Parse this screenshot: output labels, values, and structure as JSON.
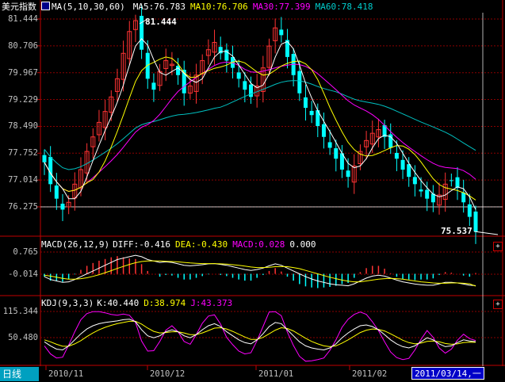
{
  "window": {
    "tab_label": "日线",
    "cursor_date": "2011/03/14,一"
  },
  "main_panel": {
    "title": "美元指数",
    "indicator": "MA(5,10,30,60)",
    "ma5": "MA5:76.783",
    "ma10": "MA10:76.706",
    "ma30": "MA30:77.399",
    "ma60": "MA60:78.418",
    "y_ticks": [
      "81.444",
      "80.706",
      "79.967",
      "79.229",
      "78.490",
      "77.752",
      "77.014",
      "76.275"
    ],
    "high_label": "81.444",
    "low_label": "75.537"
  },
  "macd_panel": {
    "title": "MACD(26,12,9)",
    "diff": "DIFF:-0.416",
    "dea": "DEA:-0.430",
    "macd": "MACD:0.028",
    "extra": "0.000",
    "y_ticks": [
      "0.765",
      "-0.014"
    ]
  },
  "kdj_panel": {
    "title": "KDJ(9,3,3)",
    "k": "K:40.440",
    "d": "D:38.974",
    "j": "J:43.373",
    "y_ticks": [
      "115.344",
      "50.480"
    ]
  },
  "x_axis": {
    "ticks": [
      "2010/11",
      "2010/12",
      "2011/01",
      "2011/02"
    ]
  },
  "colors": {
    "up": "#ff3333",
    "down": "#00ffff",
    "ma5": "#ffffff",
    "ma10": "#ffff00",
    "ma30": "#ff00ff",
    "ma60": "#00c0c0",
    "grid": "#8b0000",
    "axis": "#c00000",
    "text_gray": "#c0c0c0"
  },
  "icons": {
    "expand": "plus-icon"
  },
  "chart_data": {
    "type": "candlestick",
    "title": "美元指数",
    "price_range": [
      75.537,
      81.444
    ],
    "close": [
      77.5,
      76.9,
      76.5,
      76.2,
      76.4,
      76.9,
      77.3,
      77.8,
      78.2,
      78.6,
      78.9,
      79.3,
      79.8,
      80.5,
      81.1,
      81.4,
      80.6,
      79.8,
      79.5,
      80.0,
      80.3,
      80.2,
      79.9,
      79.4,
      79.6,
      79.9,
      80.3,
      80.6,
      80.8,
      80.5,
      80.3,
      80.1,
      79.8,
      79.5,
      79.3,
      79.6,
      80.1,
      80.7,
      81.2,
      81.0,
      80.4,
      79.9,
      79.4,
      79.0,
      78.8,
      78.5,
      78.2,
      77.9,
      77.6,
      77.3,
      77.1,
      77.4,
      77.8,
      78.1,
      78.3,
      78.4,
      78.2,
      77.9,
      77.6,
      77.3,
      77.1,
      76.9,
      76.7,
      76.5,
      76.4,
      76.6,
      76.9,
      77.0,
      76.8,
      76.4,
      76.0,
      75.6
    ],
    "macd_dif": [
      -0.1,
      -0.2,
      -0.25,
      -0.3,
      -0.28,
      -0.2,
      -0.1,
      0.0,
      0.1,
      0.2,
      0.3,
      0.4,
      0.5,
      0.55,
      0.6,
      0.65,
      0.6,
      0.5,
      0.45,
      0.4,
      0.42,
      0.4,
      0.35,
      0.3,
      0.28,
      0.3,
      0.32,
      0.35,
      0.36,
      0.33,
      0.3,
      0.25,
      0.2,
      0.15,
      0.12,
      0.15,
      0.2,
      0.28,
      0.35,
      0.3,
      0.2,
      0.1,
      0.0,
      -0.1,
      -0.18,
      -0.25,
      -0.3,
      -0.35,
      -0.38,
      -0.4,
      -0.42,
      -0.35,
      -0.25,
      -0.15,
      -0.08,
      -0.05,
      -0.08,
      -0.15,
      -0.22,
      -0.28,
      -0.32,
      -0.36,
      -0.38,
      -0.4,
      -0.4,
      -0.35,
      -0.3,
      -0.3,
      -0.32,
      -0.36,
      -0.4,
      -0.416
    ],
    "macd_dea": [
      -0.05,
      -0.08,
      -0.12,
      -0.16,
      -0.19,
      -0.19,
      -0.17,
      -0.14,
      -0.09,
      -0.03,
      0.04,
      0.11,
      0.19,
      0.26,
      0.33,
      0.39,
      0.43,
      0.45,
      0.45,
      0.45,
      0.44,
      0.43,
      0.42,
      0.4,
      0.38,
      0.37,
      0.36,
      0.36,
      0.36,
      0.35,
      0.34,
      0.32,
      0.3,
      0.27,
      0.24,
      0.22,
      0.22,
      0.23,
      0.25,
      0.26,
      0.25,
      0.22,
      0.18,
      0.12,
      0.06,
      0.0,
      -0.06,
      -0.12,
      -0.17,
      -0.22,
      -0.26,
      -0.28,
      -0.28,
      -0.25,
      -0.22,
      -0.19,
      -0.17,
      -0.16,
      -0.17,
      -0.19,
      -0.22,
      -0.25,
      -0.28,
      -0.3,
      -0.32,
      -0.33,
      -0.33,
      -0.32,
      -0.32,
      -0.33,
      -0.35,
      -0.43
    ],
    "kdj_k": [
      40,
      30,
      22,
      20,
      30,
      45,
      60,
      72,
      80,
      85,
      88,
      90,
      92,
      95,
      96,
      90,
      70,
      55,
      50,
      55,
      65,
      70,
      65,
      55,
      50,
      58,
      70,
      80,
      85,
      78,
      65,
      55,
      45,
      38,
      35,
      45,
      60,
      78,
      88,
      85,
      70,
      55,
      40,
      30,
      25,
      22,
      20,
      25,
      35,
      50,
      62,
      72,
      80,
      82,
      78,
      70,
      58,
      45,
      35,
      28,
      25,
      30,
      40,
      50,
      45,
      35,
      28,
      30,
      38,
      45,
      42,
      40.44
    ],
    "kdj_d": [
      45,
      40,
      34,
      29,
      29,
      35,
      43,
      53,
      62,
      70,
      76,
      81,
      85,
      88,
      91,
      91,
      84,
      74,
      66,
      62,
      63,
      65,
      65,
      62,
      58,
      58,
      62,
      68,
      74,
      75,
      72,
      66,
      59,
      52,
      46,
      46,
      51,
      60,
      69,
      75,
      73,
      67,
      58,
      49,
      41,
      35,
      30,
      28,
      30,
      37,
      45,
      54,
      63,
      69,
      72,
      71,
      67,
      60,
      52,
      44,
      38,
      35,
      37,
      41,
      42,
      40,
      36,
      34,
      35,
      38,
      39,
      38.974
    ],
    "kdj_j": [
      30,
      10,
      0,
      2,
      32,
      65,
      95,
      110,
      115,
      115,
      112,
      108,
      106,
      109,
      106,
      88,
      42,
      17,
      18,
      41,
      69,
      80,
      65,
      41,
      34,
      58,
      86,
      104,
      107,
      84,
      51,
      33,
      17,
      10,
      13,
      43,
      78,
      114,
      115,
      105,
      64,
      31,
      4,
      -8,
      -7,
      -4,
      0,
      19,
      45,
      76,
      96,
      108,
      114,
      108,
      90,
      68,
      40,
      15,
      1,
      -4,
      -1,
      20,
      46,
      68,
      51,
      25,
      12,
      22,
      44,
      59,
      48,
      43.373
    ]
  }
}
